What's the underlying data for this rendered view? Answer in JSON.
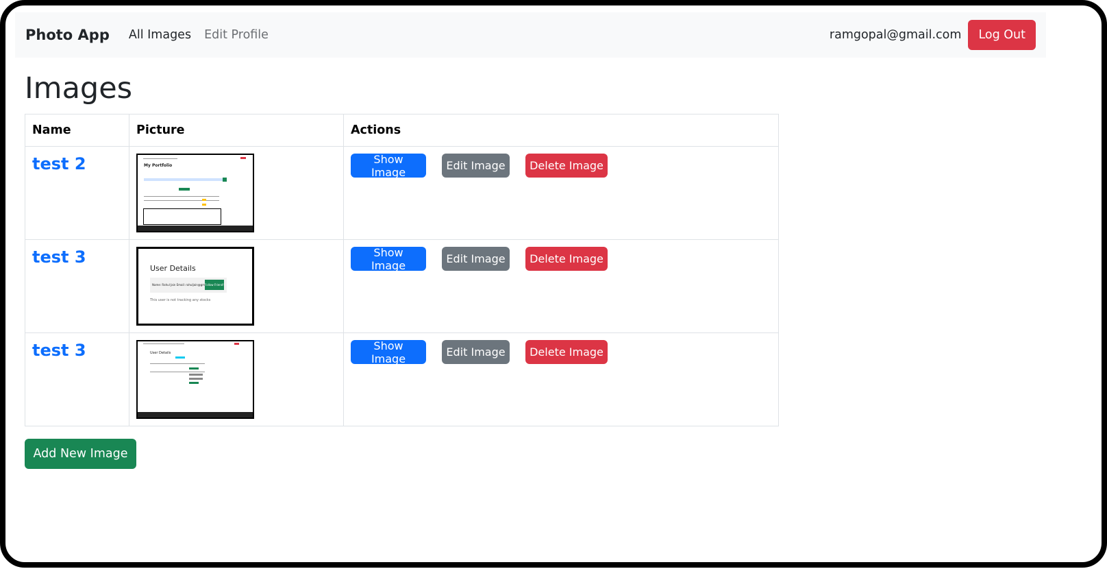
{
  "navbar": {
    "brand": "Photo App",
    "links": [
      "All Images",
      "Edit Profile"
    ],
    "user_email": "ramgopal@gmail.com",
    "logout_label": "Log Out"
  },
  "page": {
    "title": "Images"
  },
  "table": {
    "headers": [
      "Name",
      "Picture",
      "Actions"
    ],
    "rows": [
      {
        "name": "test 2",
        "picture": "portfolio-screenshot",
        "actions": {
          "show": "Show Image",
          "edit": "Edit Image",
          "delete": "Delete Image"
        }
      },
      {
        "name": "test 3",
        "picture": "user-details-screenshot",
        "actions": {
          "show": "Show Image",
          "edit": "Edit Image",
          "delete": "Delete Image"
        }
      },
      {
        "name": "test 3",
        "picture": "user-details-table-screenshot",
        "actions": {
          "show": "Show Image",
          "edit": "Edit Image",
          "delete": "Delete Image"
        }
      }
    ]
  },
  "add_button": "Add New Image",
  "thumbs": {
    "t1_heading": "My Portfolio",
    "t2_heading": "User Details",
    "t2_name": "Name: Rahul Jain Email: rahuljain@gmail.com",
    "t2_follow": "Follow Friend!",
    "t2_note": "This user is not tracking any stocks",
    "t3_heading": "User Details"
  },
  "colors": {
    "primary": "#0d6efd",
    "secondary": "#6c757d",
    "danger": "#dc3545",
    "success": "#198754"
  }
}
